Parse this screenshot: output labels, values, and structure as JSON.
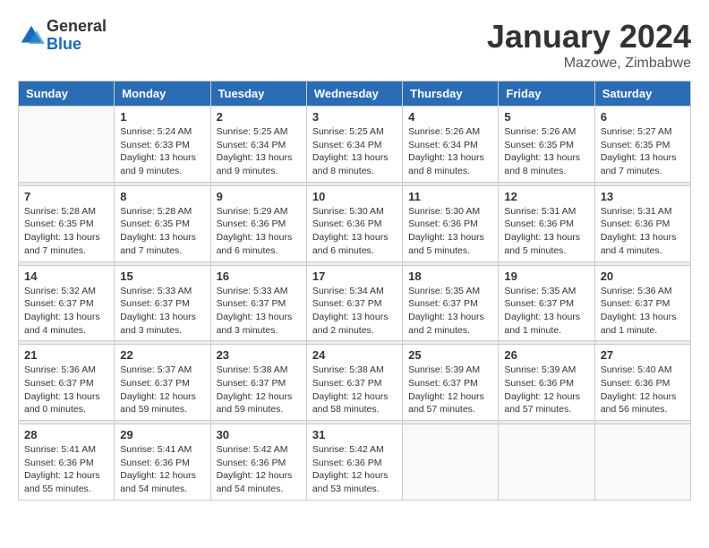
{
  "logo": {
    "general": "General",
    "blue": "Blue"
  },
  "title": "January 2024",
  "subtitle": "Mazowe, Zimbabwe",
  "days_of_week": [
    "Sunday",
    "Monday",
    "Tuesday",
    "Wednesday",
    "Thursday",
    "Friday",
    "Saturday"
  ],
  "weeks": [
    [
      {
        "day": "",
        "info": ""
      },
      {
        "day": "1",
        "info": "Sunrise: 5:24 AM\nSunset: 6:33 PM\nDaylight: 13 hours\nand 9 minutes."
      },
      {
        "day": "2",
        "info": "Sunrise: 5:25 AM\nSunset: 6:34 PM\nDaylight: 13 hours\nand 9 minutes."
      },
      {
        "day": "3",
        "info": "Sunrise: 5:25 AM\nSunset: 6:34 PM\nDaylight: 13 hours\nand 8 minutes."
      },
      {
        "day": "4",
        "info": "Sunrise: 5:26 AM\nSunset: 6:34 PM\nDaylight: 13 hours\nand 8 minutes."
      },
      {
        "day": "5",
        "info": "Sunrise: 5:26 AM\nSunset: 6:35 PM\nDaylight: 13 hours\nand 8 minutes."
      },
      {
        "day": "6",
        "info": "Sunrise: 5:27 AM\nSunset: 6:35 PM\nDaylight: 13 hours\nand 7 minutes."
      }
    ],
    [
      {
        "day": "7",
        "info": "Sunrise: 5:28 AM\nSunset: 6:35 PM\nDaylight: 13 hours\nand 7 minutes."
      },
      {
        "day": "8",
        "info": "Sunrise: 5:28 AM\nSunset: 6:35 PM\nDaylight: 13 hours\nand 7 minutes."
      },
      {
        "day": "9",
        "info": "Sunrise: 5:29 AM\nSunset: 6:36 PM\nDaylight: 13 hours\nand 6 minutes."
      },
      {
        "day": "10",
        "info": "Sunrise: 5:30 AM\nSunset: 6:36 PM\nDaylight: 13 hours\nand 6 minutes."
      },
      {
        "day": "11",
        "info": "Sunrise: 5:30 AM\nSunset: 6:36 PM\nDaylight: 13 hours\nand 5 minutes."
      },
      {
        "day": "12",
        "info": "Sunrise: 5:31 AM\nSunset: 6:36 PM\nDaylight: 13 hours\nand 5 minutes."
      },
      {
        "day": "13",
        "info": "Sunrise: 5:31 AM\nSunset: 6:36 PM\nDaylight: 13 hours\nand 4 minutes."
      }
    ],
    [
      {
        "day": "14",
        "info": "Sunrise: 5:32 AM\nSunset: 6:37 PM\nDaylight: 13 hours\nand 4 minutes."
      },
      {
        "day": "15",
        "info": "Sunrise: 5:33 AM\nSunset: 6:37 PM\nDaylight: 13 hours\nand 3 minutes."
      },
      {
        "day": "16",
        "info": "Sunrise: 5:33 AM\nSunset: 6:37 PM\nDaylight: 13 hours\nand 3 minutes."
      },
      {
        "day": "17",
        "info": "Sunrise: 5:34 AM\nSunset: 6:37 PM\nDaylight: 13 hours\nand 2 minutes."
      },
      {
        "day": "18",
        "info": "Sunrise: 5:35 AM\nSunset: 6:37 PM\nDaylight: 13 hours\nand 2 minutes."
      },
      {
        "day": "19",
        "info": "Sunrise: 5:35 AM\nSunset: 6:37 PM\nDaylight: 13 hours\nand 1 minute."
      },
      {
        "day": "20",
        "info": "Sunrise: 5:36 AM\nSunset: 6:37 PM\nDaylight: 13 hours\nand 1 minute."
      }
    ],
    [
      {
        "day": "21",
        "info": "Sunrise: 5:36 AM\nSunset: 6:37 PM\nDaylight: 13 hours\nand 0 minutes."
      },
      {
        "day": "22",
        "info": "Sunrise: 5:37 AM\nSunset: 6:37 PM\nDaylight: 12 hours\nand 59 minutes."
      },
      {
        "day": "23",
        "info": "Sunrise: 5:38 AM\nSunset: 6:37 PM\nDaylight: 12 hours\nand 59 minutes."
      },
      {
        "day": "24",
        "info": "Sunrise: 5:38 AM\nSunset: 6:37 PM\nDaylight: 12 hours\nand 58 minutes."
      },
      {
        "day": "25",
        "info": "Sunrise: 5:39 AM\nSunset: 6:37 PM\nDaylight: 12 hours\nand 57 minutes."
      },
      {
        "day": "26",
        "info": "Sunrise: 5:39 AM\nSunset: 6:36 PM\nDaylight: 12 hours\nand 57 minutes."
      },
      {
        "day": "27",
        "info": "Sunrise: 5:40 AM\nSunset: 6:36 PM\nDaylight: 12 hours\nand 56 minutes."
      }
    ],
    [
      {
        "day": "28",
        "info": "Sunrise: 5:41 AM\nSunset: 6:36 PM\nDaylight: 12 hours\nand 55 minutes."
      },
      {
        "day": "29",
        "info": "Sunrise: 5:41 AM\nSunset: 6:36 PM\nDaylight: 12 hours\nand 54 minutes."
      },
      {
        "day": "30",
        "info": "Sunrise: 5:42 AM\nSunset: 6:36 PM\nDaylight: 12 hours\nand 54 minutes."
      },
      {
        "day": "31",
        "info": "Sunrise: 5:42 AM\nSunset: 6:36 PM\nDaylight: 12 hours\nand 53 minutes."
      },
      {
        "day": "",
        "info": ""
      },
      {
        "day": "",
        "info": ""
      },
      {
        "day": "",
        "info": ""
      }
    ]
  ]
}
